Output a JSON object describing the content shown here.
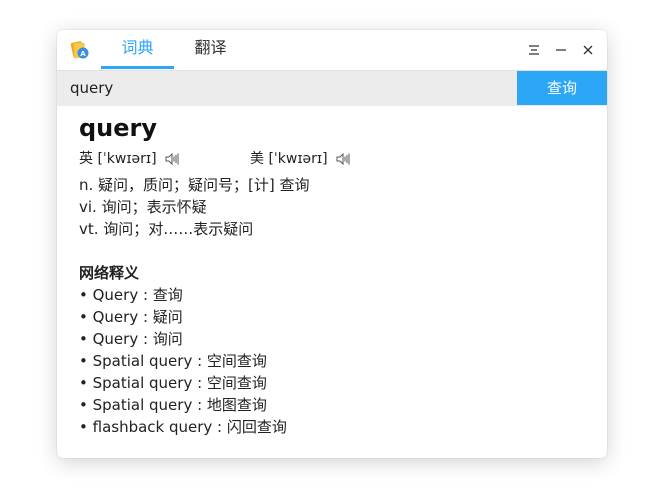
{
  "tabs": [
    {
      "label": "词典",
      "active": true
    },
    {
      "label": "翻译",
      "active": false
    }
  ],
  "search": {
    "value": "query",
    "button_label": "查询"
  },
  "result": {
    "word": "query",
    "phonetics": [
      {
        "label": "英 [ˈkwɪərɪ]",
        "icon": "speaker-icon"
      },
      {
        "label": "美 [ˈkwɪərɪ]",
        "icon": "speaker-icon"
      }
    ],
    "definitions": [
      "n. 疑问，质问；疑问号；[计] 查询",
      "vi. 询问；表示怀疑",
      "vt. 询问；对……表示疑问"
    ],
    "web_section_title": "网络释义",
    "web_items": [
      "• Query : 查询",
      "• Query : 疑问",
      "• Query : 询问",
      "• Spatial query : 空间查询",
      "• Spatial query : 空间查询",
      "• Spatial query : 地图查询",
      "• flashback query : 闪回查询"
    ]
  },
  "colors": {
    "accent": "#2ca7f8",
    "search_bg": "#ececec"
  },
  "icons": {
    "app": "dictionary-app-icon",
    "menu": "menu-icon",
    "minimize": "minimize-icon",
    "close": "close-icon"
  }
}
